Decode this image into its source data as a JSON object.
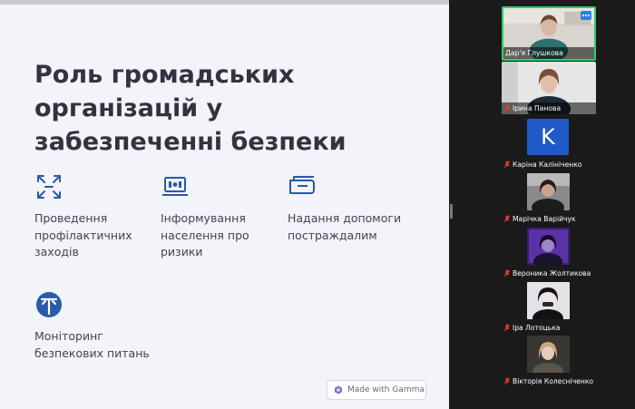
{
  "slide": {
    "title": "Роль громадських організацій у забезпеченні безпеки",
    "features": [
      {
        "icon": "arrows-expand-icon",
        "text": "Проведення\nпрофілактичних\nзаходів"
      },
      {
        "icon": "laptop-icon",
        "text": "Інформування\nнаселення про\nризики"
      },
      {
        "icon": "ticket-icon",
        "text": "Надання допомоги\nпостраждалим"
      },
      {
        "icon": "monitoring-icon",
        "text": "Моніторинг\nбезпекових питань"
      }
    ],
    "badge": "Made with Gamma"
  },
  "participants": [
    {
      "name": "Дар'я Глушкова",
      "muted": false,
      "active": true,
      "avatar": "video"
    },
    {
      "name": "Ірина Панова",
      "muted": true,
      "active": false,
      "avatar": "video"
    },
    {
      "name": "Каріна Калініченко",
      "muted": true,
      "active": false,
      "avatar": "letter",
      "letter": "K"
    },
    {
      "name": "Марічка Варійчук",
      "muted": true,
      "active": false,
      "avatar": "picture"
    },
    {
      "name": "Вероника Жолтикова",
      "muted": true,
      "active": false,
      "avatar": "picture"
    },
    {
      "name": "Іра Лотоцька",
      "muted": true,
      "active": false,
      "avatar": "picture"
    },
    {
      "name": "Вікторія Колесніченко",
      "muted": true,
      "active": false,
      "avatar": "picture"
    }
  ],
  "colors": {
    "accent_icon": "#2a5aa8",
    "active_speaker": "#2ad16b",
    "muted_mic": "#e23b3b",
    "letter_avatar": "#1e5ac8"
  }
}
